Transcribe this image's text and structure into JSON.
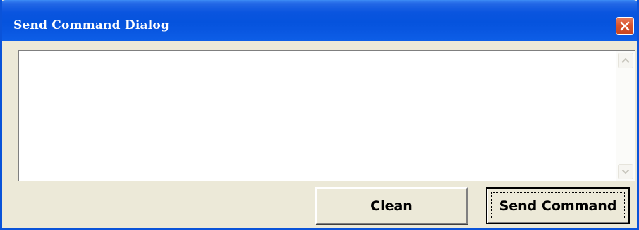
{
  "window": {
    "title": "Send Command Dialog",
    "close_icon": "close-icon"
  },
  "command_input": {
    "value": ""
  },
  "scrollbar": {
    "up_icon": "chevron-up-icon",
    "down_icon": "chevron-down-icon"
  },
  "buttons": {
    "clean_label": "Clean",
    "send_label": "Send Command"
  },
  "colors": {
    "titlebar": "#0553dd",
    "close_button": "#d8542e",
    "dialog_background": "#ece9d8"
  }
}
